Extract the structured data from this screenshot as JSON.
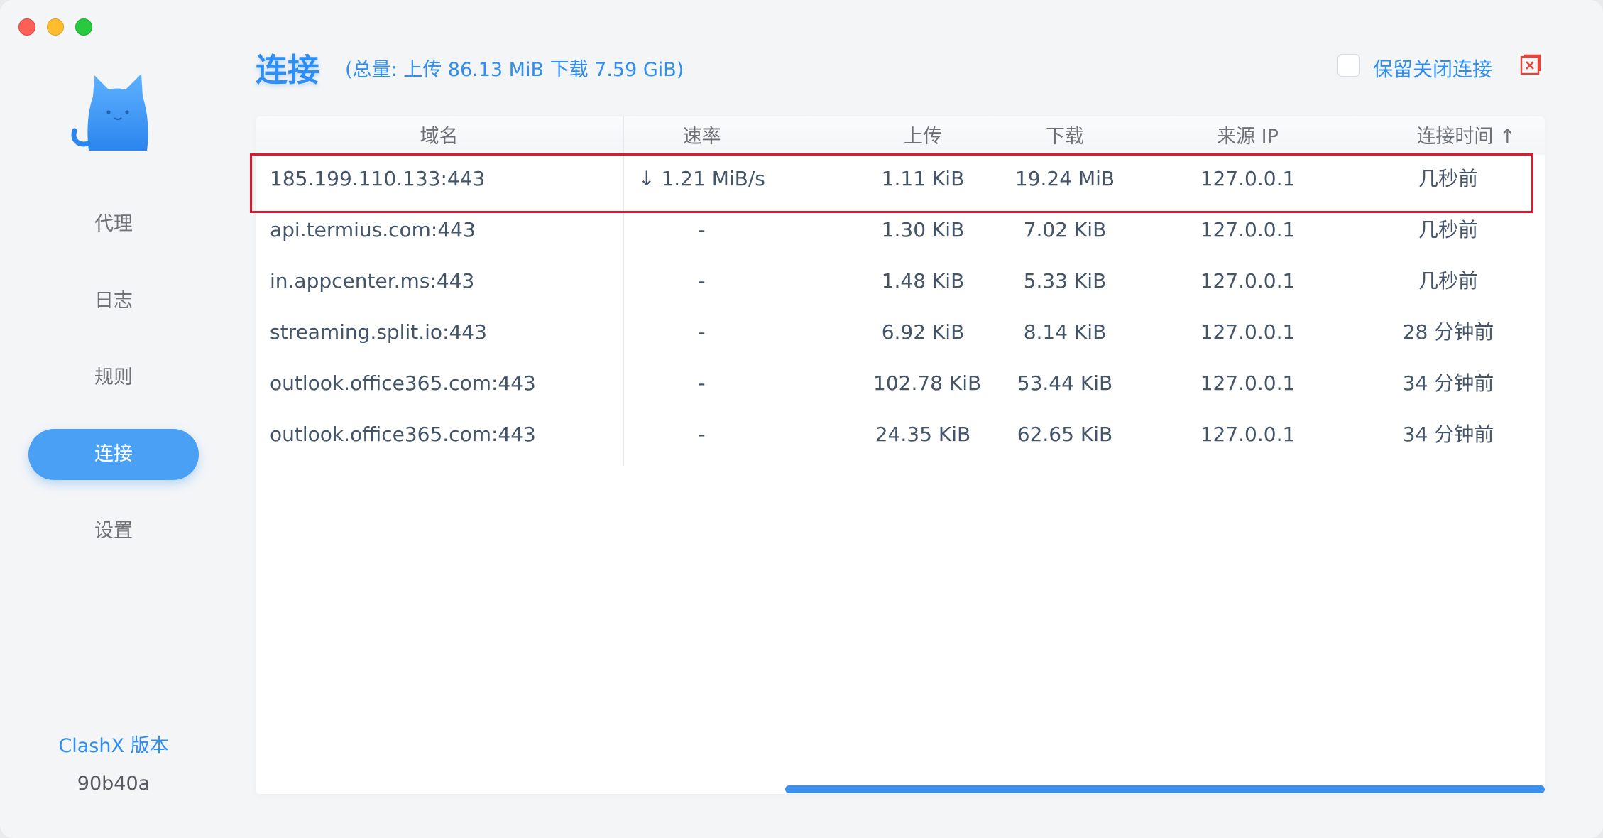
{
  "sidebar": {
    "items": [
      {
        "label": "代理"
      },
      {
        "label": "日志"
      },
      {
        "label": "规则"
      },
      {
        "label": "连接"
      },
      {
        "label": "设置"
      }
    ],
    "active_index": 3,
    "version_label": "ClashX 版本",
    "version_value": "90b40a"
  },
  "header": {
    "title": "连接",
    "totals": "(总量: 上传 86.13 MiB 下载 7.59 GiB)",
    "keep_closed_label": "保留关闭连接",
    "close_all_icon": "close-all-icon"
  },
  "table": {
    "columns": [
      "域名",
      "速率",
      "上传",
      "下载",
      "来源 IP",
      "连接时间 ↑"
    ],
    "rows": [
      {
        "domain": "185.199.110.133:443",
        "speed": "↓ 1.21 MiB/s",
        "upload": "1.11 KiB",
        "download": "19.24 MiB",
        "source_ip": "127.0.0.1",
        "time": "几秒前"
      },
      {
        "domain": "api.termius.com:443",
        "speed": "-",
        "upload": "1.30 KiB",
        "download": "7.02 KiB",
        "source_ip": "127.0.0.1",
        "time": "几秒前"
      },
      {
        "domain": "in.appcenter.ms:443",
        "speed": "-",
        "upload": "1.48 KiB",
        "download": "5.33 KiB",
        "source_ip": "127.0.0.1",
        "time": "几秒前"
      },
      {
        "domain": "streaming.split.io:443",
        "speed": "-",
        "upload": "6.92 KiB",
        "download": "8.14 KiB",
        "source_ip": "127.0.0.1",
        "time": "28 分钟前"
      },
      {
        "domain": "outlook.office365.com:443",
        "speed": "-",
        "upload": "102.78 KiB",
        "download": "53.44 KiB",
        "source_ip": "127.0.0.1",
        "time": "34 分钟前"
      },
      {
        "domain": "outlook.office365.com:443",
        "speed": "-",
        "upload": "24.35 KiB",
        "download": "62.65 KiB",
        "source_ip": "127.0.0.1",
        "time": "34 分钟前"
      }
    ]
  },
  "colors": {
    "accent": "#2f8ef3",
    "active_nav": "#4aa0f5",
    "highlight": "#e0182d",
    "close_icon": "#e8443a"
  }
}
